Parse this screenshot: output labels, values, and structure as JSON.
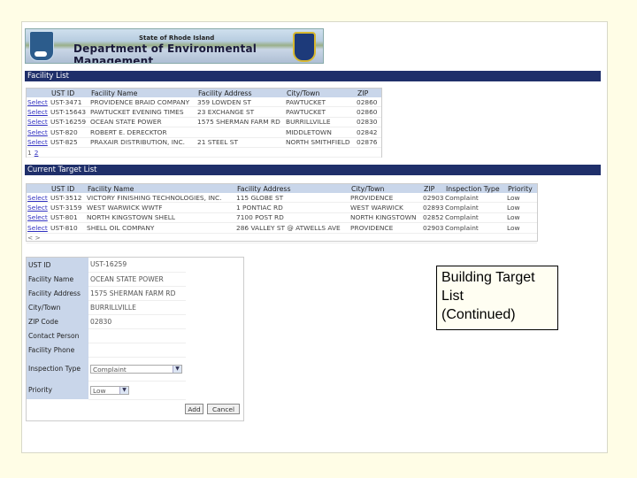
{
  "banner": {
    "state": "State of Rhode Island",
    "department": "Department of Environmental Management"
  },
  "facility_list": {
    "title": "Facility List",
    "columns": [
      "",
      "UST ID",
      "Facility Name",
      "Facility Address",
      "City/Town",
      "ZIP"
    ],
    "select_label": "Select",
    "rows": [
      [
        "UST-3471",
        "PROVIDENCE BRAID COMPANY",
        "359 LOWDEN ST",
        "PAWTUCKET",
        "02860"
      ],
      [
        "UST-15643",
        "PAWTUCKET EVENING TIMES",
        "23 EXCHANGE ST",
        "PAWTUCKET",
        "02860"
      ],
      [
        "UST-16259",
        "OCEAN STATE POWER",
        "1575 SHERMAN FARM RD",
        "BURRILLVILLE",
        "02830"
      ],
      [
        "UST-820",
        "ROBERT E. DERECKTOR",
        "",
        "MIDDLETOWN",
        "02842"
      ],
      [
        "UST-825",
        "PRAXAIR DISTRIBUTION, INC.",
        "21 STEEL ST",
        "NORTH SMITHFIELD",
        "02876"
      ]
    ],
    "pager": [
      "1",
      "2"
    ]
  },
  "target_list": {
    "title": "Current Target List",
    "columns": [
      "",
      "UST ID",
      "Facility Name",
      "Facility Address",
      "City/Town",
      "ZIP",
      "Inspection Type",
      "Priority"
    ],
    "select_label": "Select",
    "rows": [
      [
        "UST-3512",
        "VICTORY FINISHING TECHNOLOGIES, INC.",
        "115 GLOBE ST",
        "PROVIDENCE",
        "02903",
        "Complaint",
        "Low"
      ],
      [
        "UST-3159",
        "WEST WARWICK WWTF",
        "1 PONTIAC RD",
        "WEST WARWICK",
        "02893",
        "Complaint",
        "Low"
      ],
      [
        "UST-801",
        "NORTH KINGSTOWN SHELL",
        "7100 POST RD",
        "NORTH KINGSTOWN",
        "02852",
        "Complaint",
        "Low"
      ],
      [
        "UST-810",
        "SHELL OIL COMPANY",
        "286 VALLEY ST @ ATWELLS AVE",
        "PROVIDENCE",
        "02903",
        "Complaint",
        "Low"
      ]
    ],
    "pager": "< >"
  },
  "form": {
    "fields": [
      {
        "label": "UST ID",
        "value": "UST-16259"
      },
      {
        "label": "Facility Name",
        "value": "OCEAN STATE POWER"
      },
      {
        "label": "Facility Address",
        "value": "1575 SHERMAN FARM RD"
      },
      {
        "label": "City/Town",
        "value": "BURRILLVILLE"
      },
      {
        "label": "ZIP Code",
        "value": "02830"
      },
      {
        "label": "Contact Person",
        "value": ""
      },
      {
        "label": "Facility Phone",
        "value": ""
      }
    ],
    "inspection_type": {
      "label": "Inspection Type",
      "value": "Complaint"
    },
    "priority": {
      "label": "Priority",
      "value": "Low"
    },
    "add_label": "Add",
    "cancel_label": "Cancel"
  },
  "callout": {
    "line1": "Building Target",
    "line2": "List",
    "line3": "(Continued)"
  }
}
